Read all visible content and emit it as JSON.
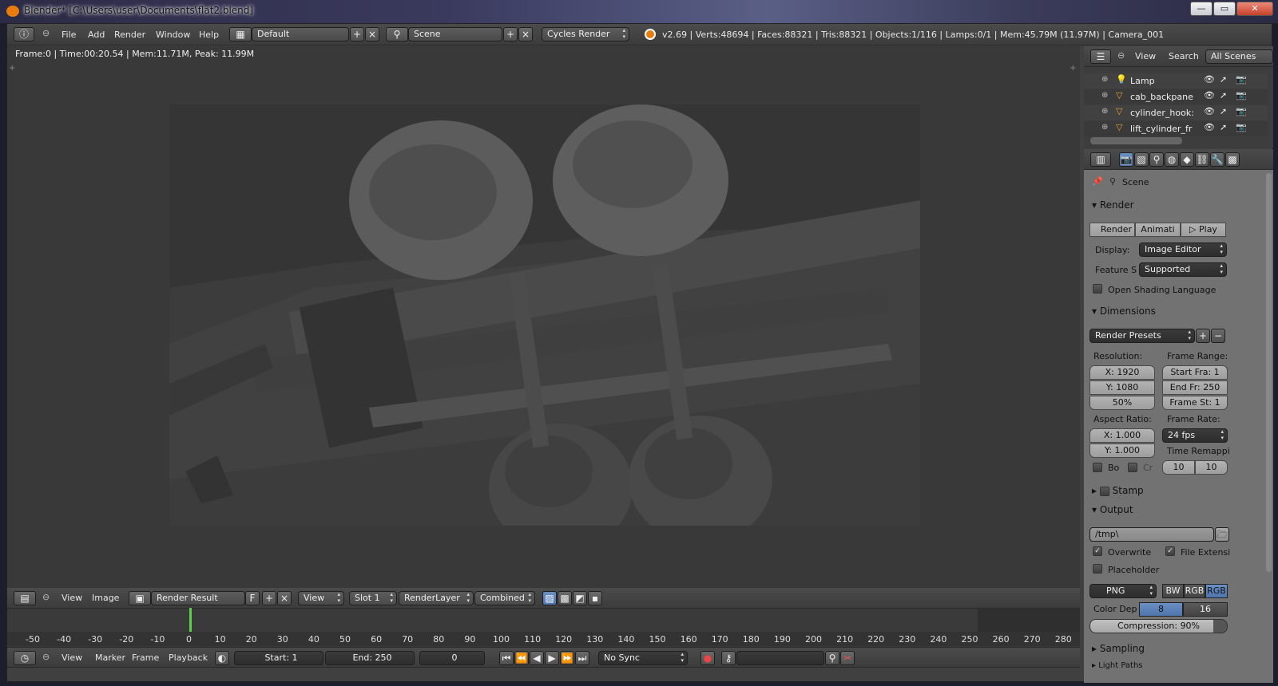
{
  "window": {
    "title": "Blender* [C:\\Users\\user\\Documents\\flat2.blend]",
    "controls": {
      "minimize": "—",
      "maximize": "▭",
      "close": "✕"
    }
  },
  "top_header": {
    "menus": [
      "File",
      "Add",
      "Render",
      "Window",
      "Help"
    ],
    "layout": "Default",
    "scene": "Scene",
    "engine": "Cycles Render",
    "stats": "v2.69 | Verts:48694 | Faces:88321 | Tris:88321 | Objects:1/116 | Lamps:0/1 | Mem:45.79M (11.97M) | Camera_001"
  },
  "viewport": {
    "info": "Frame:0 | Time:00:20.54 | Mem:11.71M, Peak: 11.99M"
  },
  "image_editor_header": {
    "menus": [
      "View",
      "Image"
    ],
    "image_name": "Render Result",
    "fake_user": "F",
    "view": "View",
    "slot": "Slot 1",
    "layer": "RenderLayer",
    "pass": "Combined"
  },
  "outliner": {
    "menus": [
      "View",
      "Search"
    ],
    "display": "All Scenes",
    "items": [
      {
        "name": "Lamp",
        "icon": "lamp-icon"
      },
      {
        "name": "cab_backpane",
        "icon": "mesh-icon"
      },
      {
        "name": "cylinder_hook:",
        "icon": "mesh-icon"
      },
      {
        "name": "lift_cylinder_fr",
        "icon": "mesh-icon"
      }
    ]
  },
  "properties": {
    "context": "Scene",
    "render": {
      "title": "Render",
      "buttons": [
        "Render",
        "Animati",
        "Play"
      ],
      "display_label": "Display:",
      "display_value": "Image Editor",
      "feature_label": "Feature S",
      "feature_value": "Supported",
      "osl_label": "Open Shading Language"
    },
    "dimensions": {
      "title": "Dimensions",
      "presets": "Render Presets",
      "resolution_label": "Resolution:",
      "res_x": "X: 1920",
      "res_y": "Y: 1080",
      "res_pct": "50%",
      "frame_range_label": "Frame Range:",
      "start": "Start Fra: 1",
      "end": "End Fr: 250",
      "step": "Frame St: 1",
      "aspect_label": "Aspect Ratio:",
      "aspect_x": "X: 1.000",
      "aspect_y": "Y: 1.000",
      "frame_rate_label": "Frame Rate:",
      "fps": "24 fps",
      "time_remap_label": "Time Remappi",
      "remap_old": "10",
      "remap_new": "10",
      "border_label": "Bo",
      "crop_label": "Cr"
    },
    "stamp": {
      "title": "Stamp"
    },
    "output": {
      "title": "Output",
      "path": "/tmp\\",
      "overwrite": "Overwrite",
      "file_ext": "File Extensi",
      "placeholder": "Placeholder",
      "format": "PNG",
      "bw": "BW",
      "rgb": "RGB",
      "rgba": "RGB",
      "color_depth_label": "Color Dep",
      "depth_8": "8",
      "depth_16": "16",
      "compression": "Compression: 90%",
      "compression_value": 0.9
    },
    "sampling": {
      "title": "Sampling"
    },
    "light_paths": {
      "title": "Light Paths"
    }
  },
  "timeline": {
    "ticks": [
      "-50",
      "-40",
      "-30",
      "-20",
      "-10",
      "0",
      "10",
      "20",
      "30",
      "40",
      "50",
      "60",
      "70",
      "80",
      "90",
      "100",
      "110",
      "120",
      "130",
      "140",
      "150",
      "160",
      "170",
      "180",
      "190",
      "200",
      "210",
      "220",
      "230",
      "240",
      "250",
      "260",
      "270",
      "280"
    ],
    "menus": [
      "View",
      "Marker",
      "Frame",
      "Playback"
    ],
    "start": "Start: 1",
    "end": "End: 250",
    "current": "0",
    "sync": "No Sync"
  },
  "colors": {
    "accent": "#5a7fb8",
    "blender_orange": "#e87d0d",
    "panel_bg": "#727272",
    "viewport_bg": "#393939"
  }
}
